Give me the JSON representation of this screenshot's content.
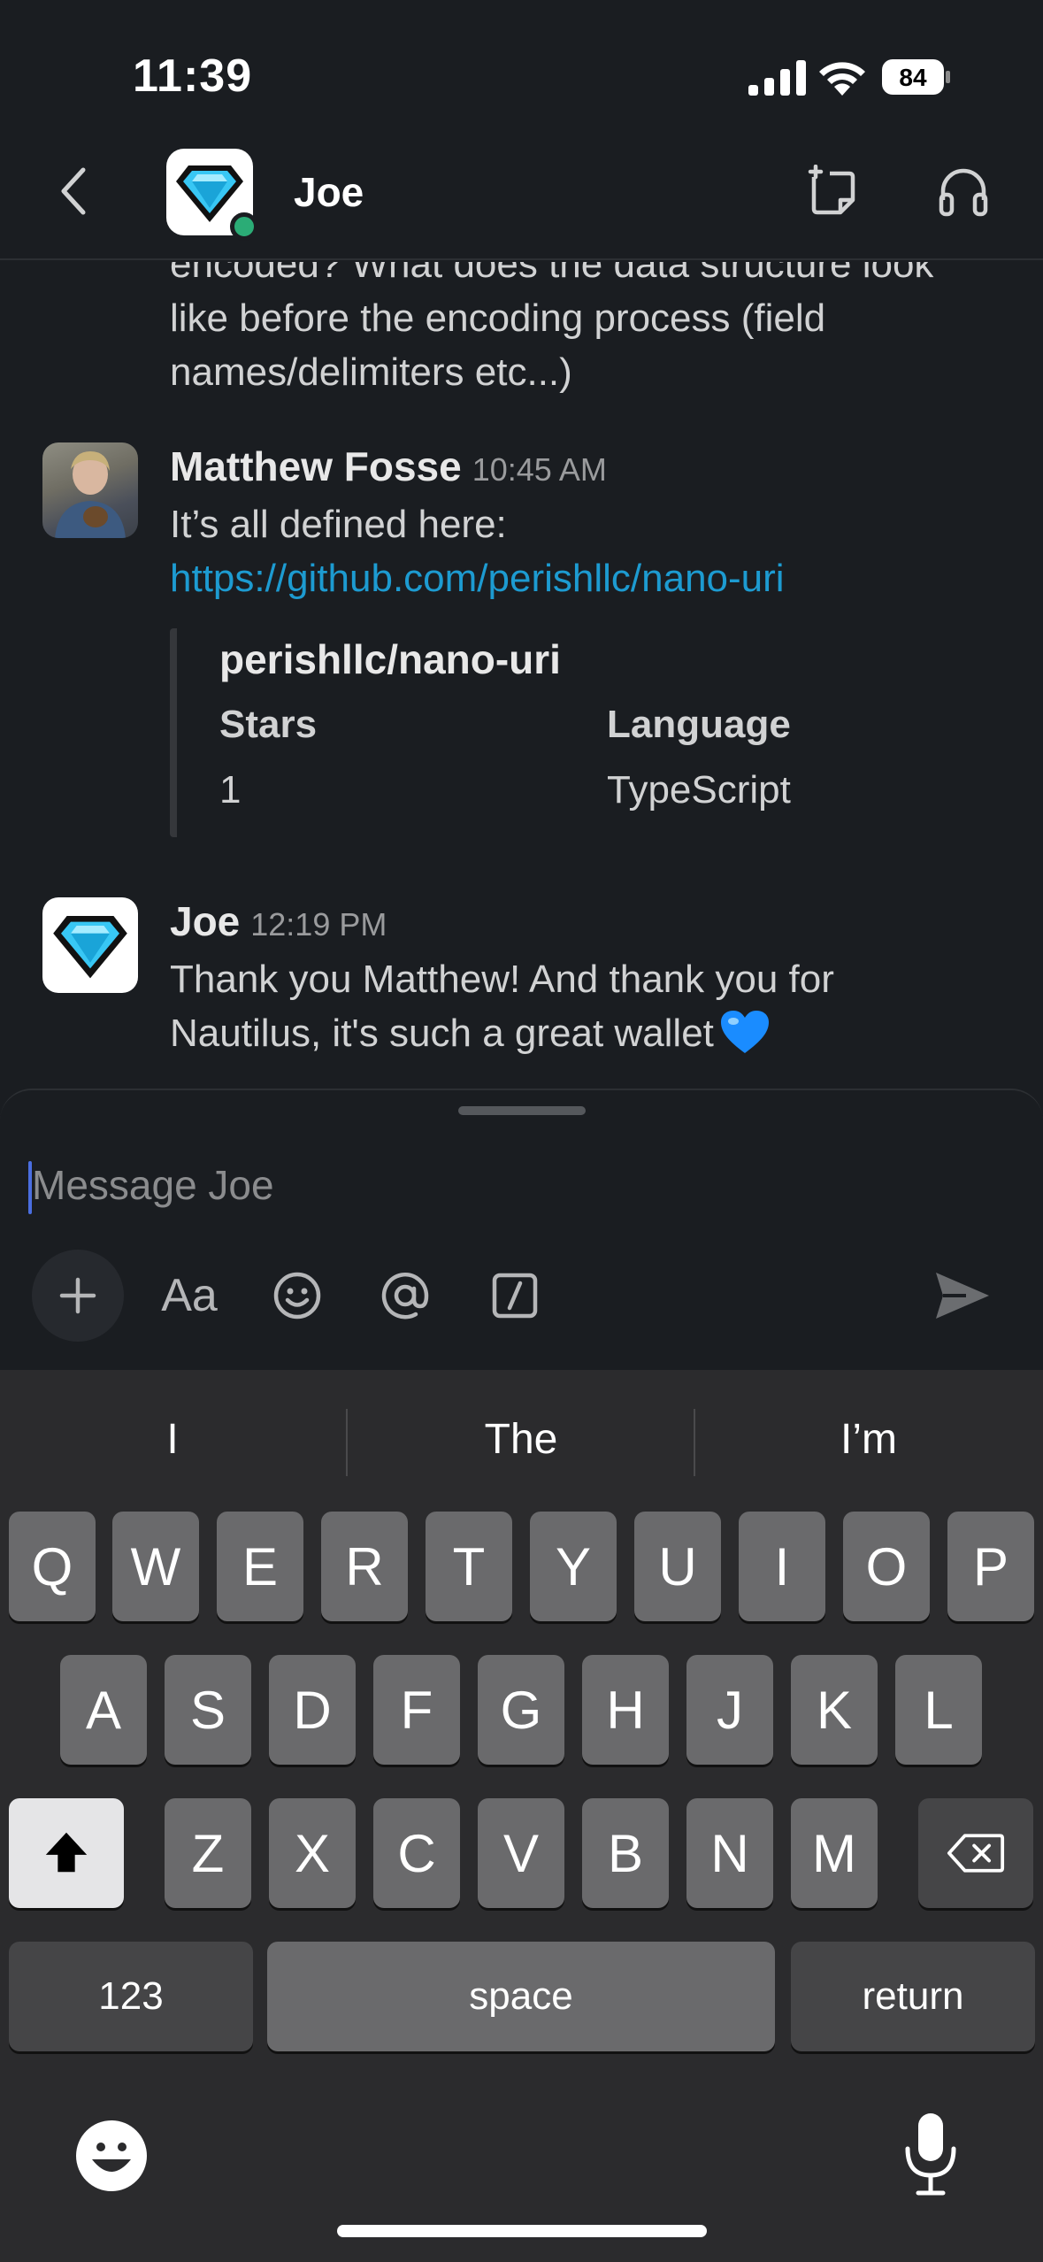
{
  "status_bar": {
    "time": "11:39",
    "battery": "84"
  },
  "header": {
    "contact_name": "Joe"
  },
  "messages": {
    "partial": "encoded? What does the data structure look like before the encoding process (field names/delimiters etc...)",
    "items": [
      {
        "sender": "Matthew Fosse",
        "time": "10:45 AM",
        "text": "It’s all defined here:",
        "link": "https://github.com/perishllc/nano-uri",
        "unfurl": {
          "title": "perishllc/nano-uri",
          "fields": [
            {
              "label": "Stars",
              "value": "1"
            },
            {
              "label": "Language",
              "value": "TypeScript"
            }
          ]
        }
      },
      {
        "sender": "Joe",
        "time": "12:19 PM",
        "text": "Thank you Matthew! And thank you for Nautilus, it's such a great wallet",
        "emoji": "blue-heart"
      }
    ]
  },
  "composer": {
    "placeholder": "Message Joe",
    "format_label": "Aa"
  },
  "keyboard": {
    "suggestions": [
      "I",
      "The",
      "I’m"
    ],
    "row1": [
      "Q",
      "W",
      "E",
      "R",
      "T",
      "Y",
      "U",
      "I",
      "O",
      "P"
    ],
    "row2": [
      "A",
      "S",
      "D",
      "F",
      "G",
      "H",
      "J",
      "K",
      "L"
    ],
    "row3": [
      "Z",
      "X",
      "C",
      "V",
      "B",
      "N",
      "M"
    ],
    "numbers_label": "123",
    "space_label": "space",
    "return_label": "return"
  },
  "colors": {
    "link": "#1d9bd1",
    "presence": "#2bac76",
    "background": "#1a1d21"
  }
}
